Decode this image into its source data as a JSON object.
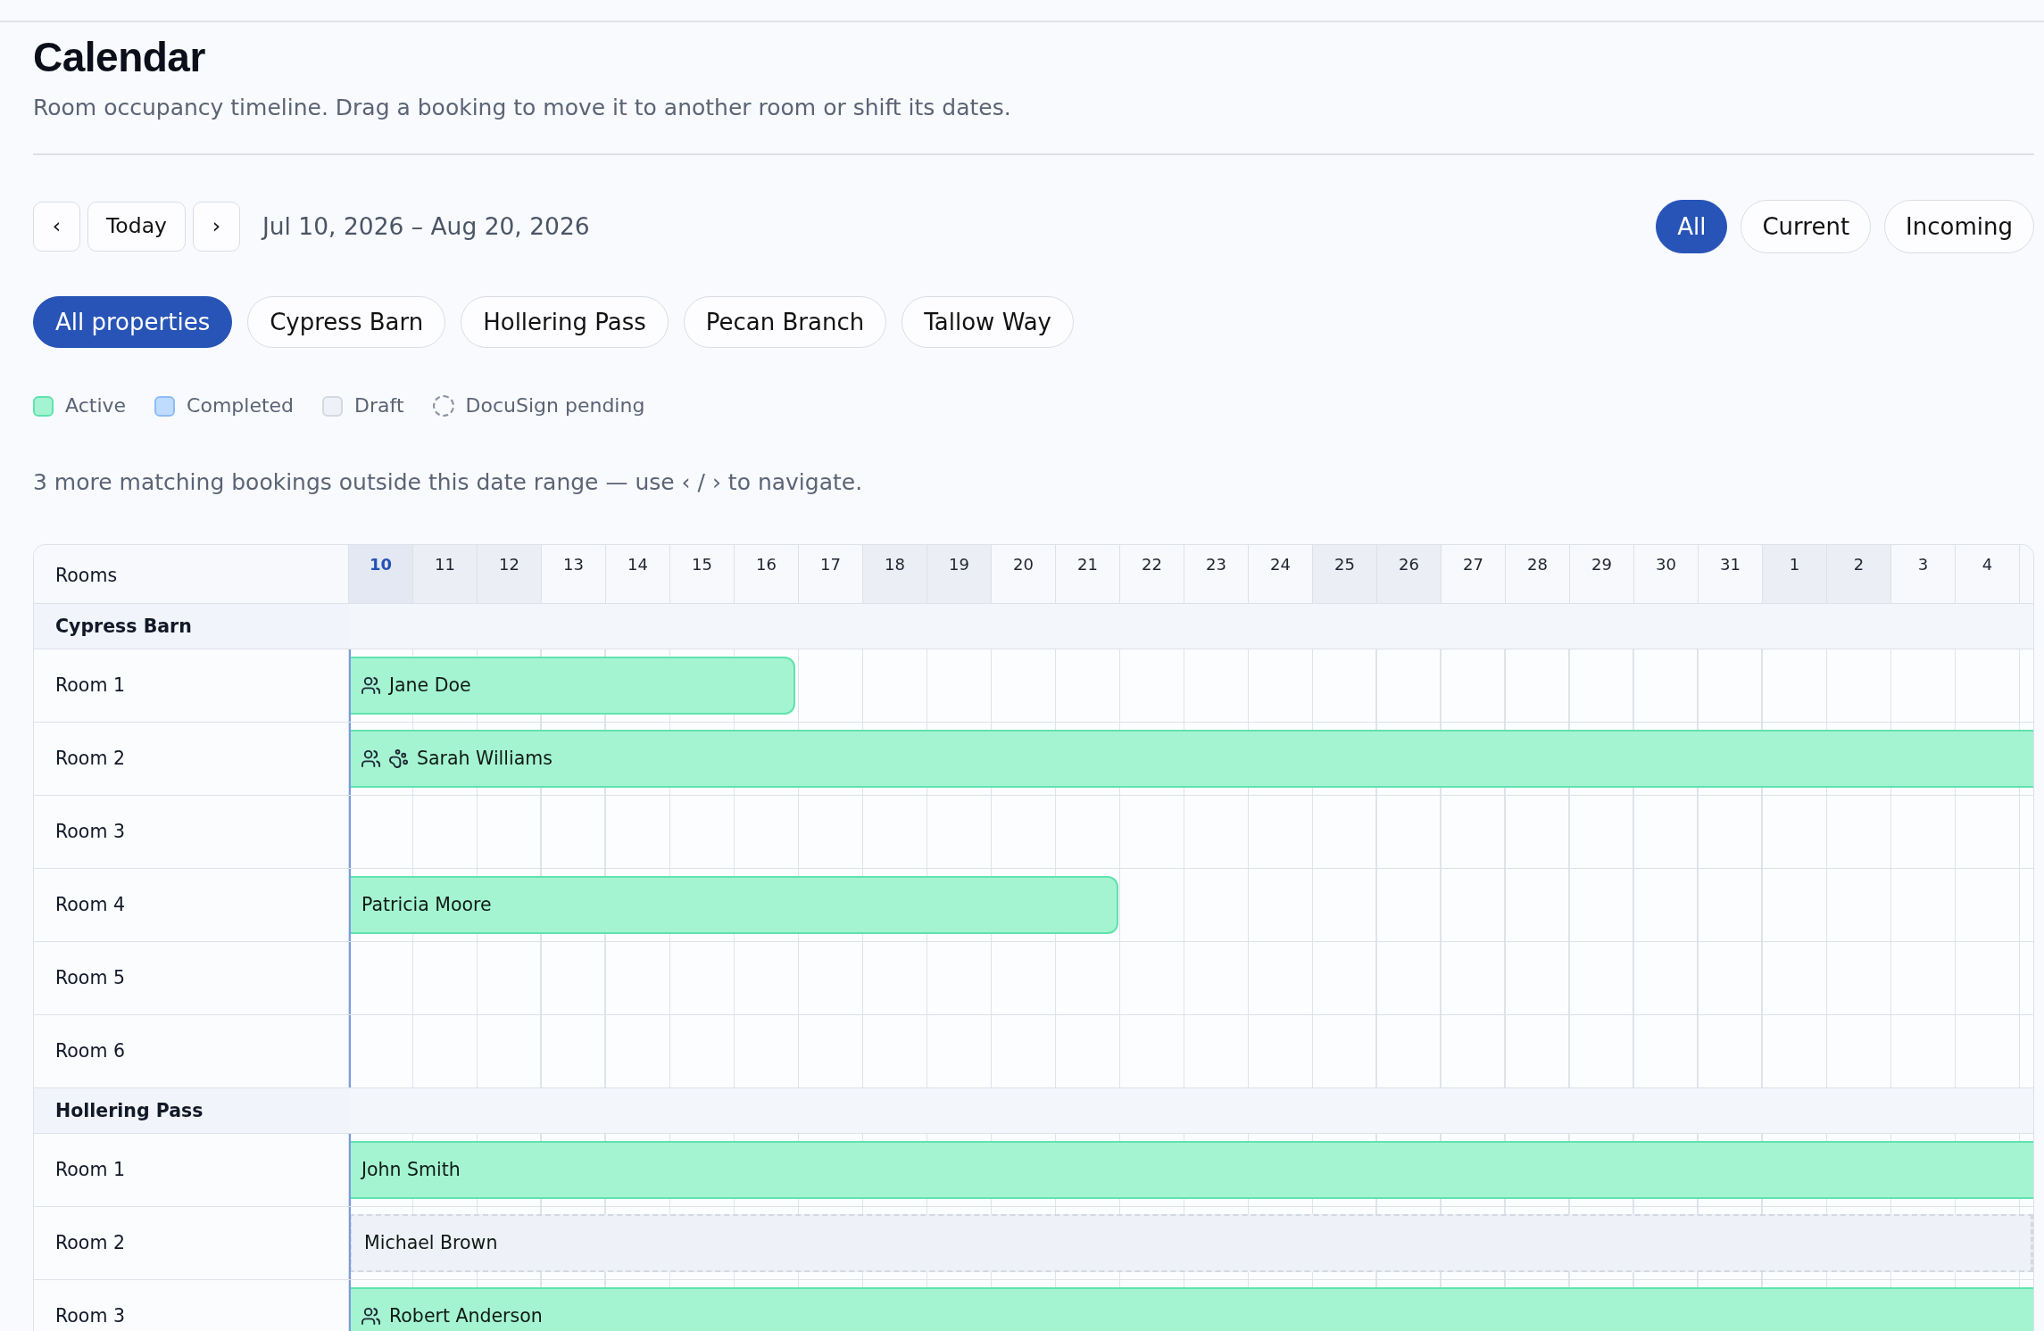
{
  "page": {
    "title": "Calendar",
    "subtitle": "Room occupancy timeline. Drag a booking to move it to another room or shift its dates."
  },
  "toolbar": {
    "prev": "‹",
    "today": "Today",
    "next": "›",
    "date_range": "Jul 10, 2026 – Aug 20, 2026"
  },
  "status_filters": [
    {
      "label": "All",
      "selected": true
    },
    {
      "label": "Current",
      "selected": false
    },
    {
      "label": "Incoming",
      "selected": false
    }
  ],
  "property_filters": [
    {
      "label": "All properties",
      "selected": true
    },
    {
      "label": "Cypress Barn",
      "selected": false
    },
    {
      "label": "Hollering Pass",
      "selected": false
    },
    {
      "label": "Pecan Branch",
      "selected": false
    },
    {
      "label": "Tallow Way",
      "selected": false
    }
  ],
  "legend": [
    {
      "kind": "active",
      "label": "Active"
    },
    {
      "kind": "completed",
      "label": "Completed"
    },
    {
      "kind": "draft",
      "label": "Draft"
    },
    {
      "kind": "pending",
      "label": "DocuSign pending"
    }
  ],
  "notice": "3 more matching bookings outside this date range — use ‹ / › to navigate.",
  "timeline": {
    "rooms_header": "Rooms",
    "days": [
      {
        "label": "10",
        "today": true,
        "weekend": false
      },
      {
        "label": "11",
        "today": false,
        "weekend": true
      },
      {
        "label": "12",
        "today": false,
        "weekend": true
      },
      {
        "label": "13",
        "today": false,
        "weekend": false
      },
      {
        "label": "14",
        "today": false,
        "weekend": false
      },
      {
        "label": "15",
        "today": false,
        "weekend": false
      },
      {
        "label": "16",
        "today": false,
        "weekend": false
      },
      {
        "label": "17",
        "today": false,
        "weekend": false
      },
      {
        "label": "18",
        "today": false,
        "weekend": true
      },
      {
        "label": "19",
        "today": false,
        "weekend": true
      },
      {
        "label": "20",
        "today": false,
        "weekend": false
      },
      {
        "label": "21",
        "today": false,
        "weekend": false
      },
      {
        "label": "22",
        "today": false,
        "weekend": false
      },
      {
        "label": "23",
        "today": false,
        "weekend": false
      },
      {
        "label": "24",
        "today": false,
        "weekend": false
      },
      {
        "label": "25",
        "today": false,
        "weekend": true
      },
      {
        "label": "26",
        "today": false,
        "weekend": true
      },
      {
        "label": "27",
        "today": false,
        "weekend": false
      },
      {
        "label": "28",
        "today": false,
        "weekend": false
      },
      {
        "label": "29",
        "today": false,
        "weekend": false
      },
      {
        "label": "30",
        "today": false,
        "weekend": false
      },
      {
        "label": "31",
        "today": false,
        "weekend": false
      },
      {
        "label": "1",
        "today": false,
        "weekend": true
      },
      {
        "label": "2",
        "today": false,
        "weekend": true
      },
      {
        "label": "3",
        "today": false,
        "weekend": false
      },
      {
        "label": "4",
        "today": false,
        "weekend": false
      }
    ],
    "groups": [
      {
        "name": "Cypress Barn",
        "rooms": [
          {
            "name": "Room 1",
            "bookings": [
              {
                "guest": "Jane Doe",
                "kind": "active",
                "docusign_pending": false,
                "icons": [
                  {
                    "kind": "guests"
                  }
                ],
                "continues_left": true,
                "continues_right": false,
                "level": 0.265
              }
            ]
          },
          {
            "name": "Room 2",
            "bookings": [
              {
                "guest": "Sarah Williams",
                "kind": "active",
                "docusign_pending": false,
                "icons": [
                  {
                    "kind": "guests"
                  },
                  {
                    "kind": "pet"
                  }
                ],
                "continues_left": true,
                "continues_right": true,
                "level": 1
              }
            ]
          },
          {
            "name": "Room 3"
          },
          {
            "name": "Room 4",
            "bookings": [
              {
                "guest": "Patricia Moore",
                "kind": "active",
                "docusign_pending": false,
                "continues_left": true,
                "continues_right": false,
                "level": 0.457
              }
            ]
          },
          {
            "name": "Room 5"
          },
          {
            "name": "Room 6"
          }
        ]
      },
      {
        "name": "Hollering Pass",
        "rooms": [
          {
            "name": "Room 1",
            "bookings": [
              {
                "guest": "John Smith",
                "kind": "active",
                "docusign_pending": false,
                "continues_left": true,
                "continues_right": true,
                "level": 1
              }
            ]
          },
          {
            "name": "Room 2",
            "bookings": [
              {
                "guest": "Michael Brown",
                "kind": "draft",
                "docusign_pending": true,
                "continues_left": true,
                "continues_right": true,
                "level": 1
              }
            ]
          },
          {
            "name": "Room 3",
            "bookings": [
              {
                "guest": "Robert Anderson",
                "kind": "active",
                "docusign_pending": false,
                "icons": [
                  {
                    "kind": "guests"
                  }
                ],
                "continues_left": true,
                "continues_right": true,
                "level": 1
              }
            ]
          }
        ]
      }
    ]
  }
}
